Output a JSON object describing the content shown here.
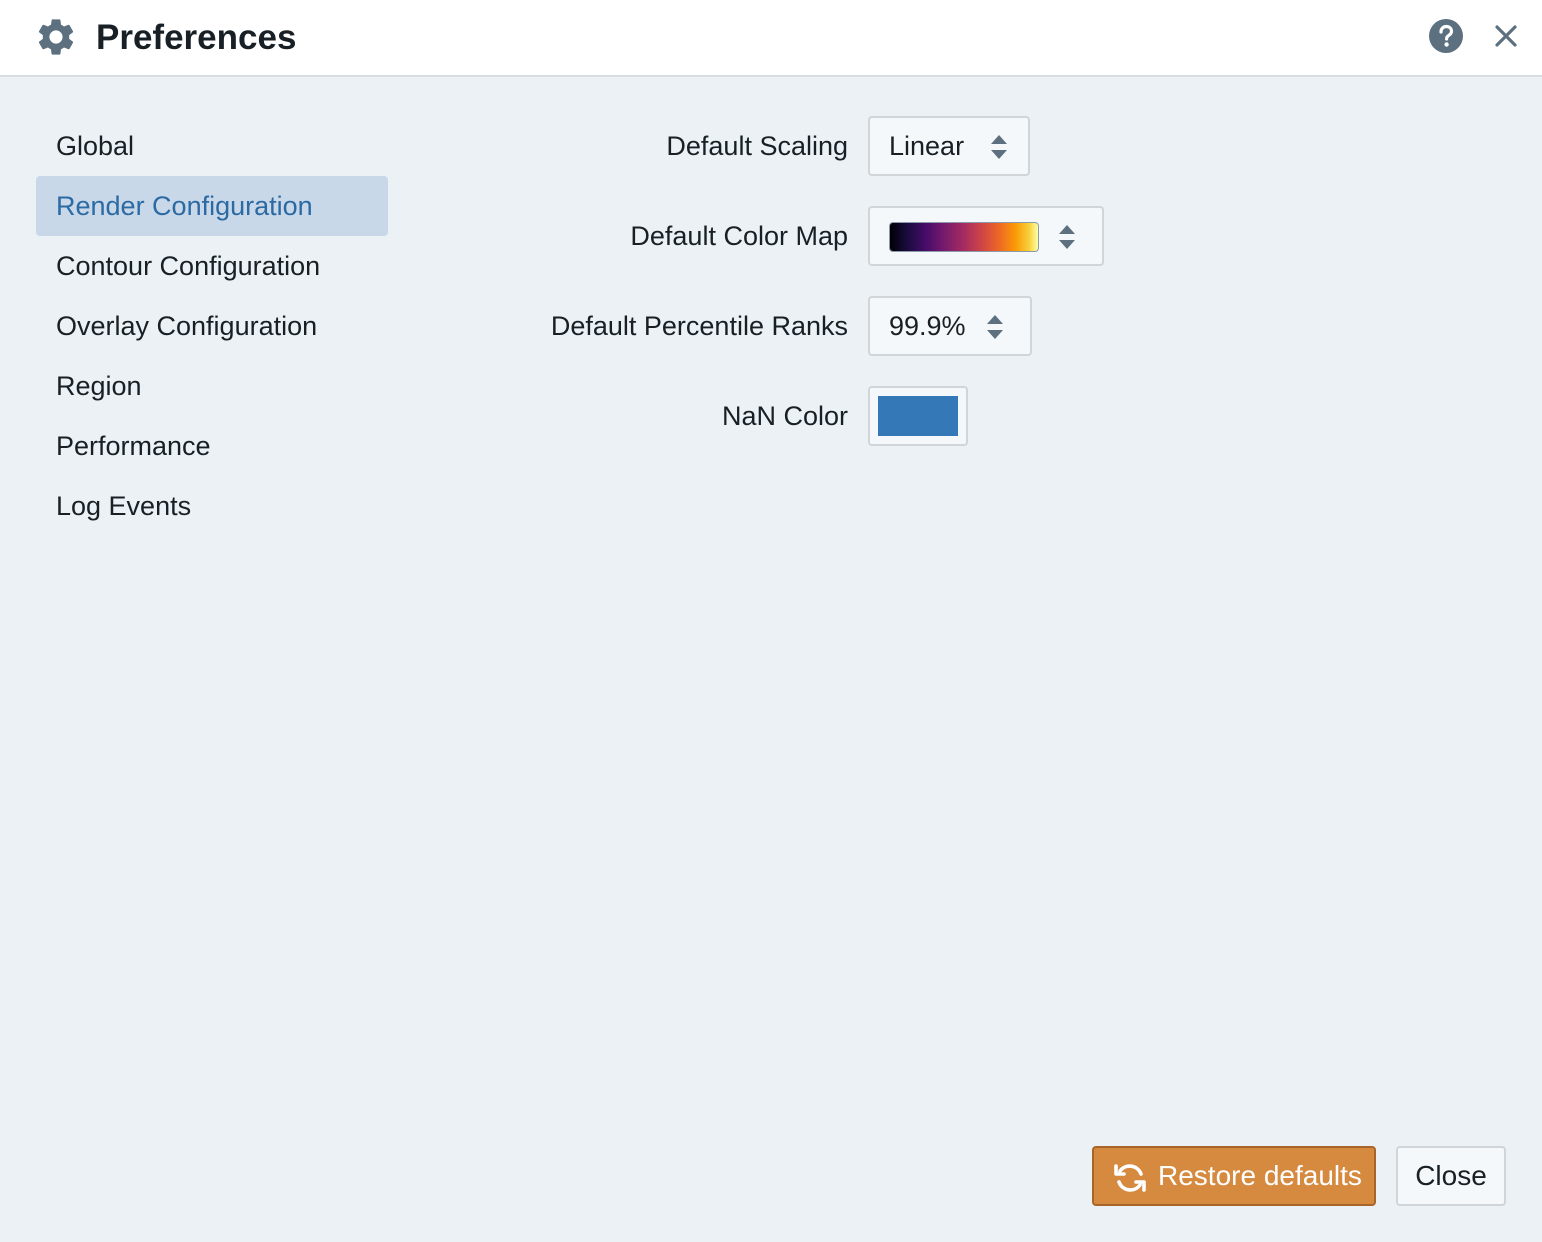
{
  "header": {
    "title": "Preferences",
    "icons": {
      "left": "gear-icon",
      "help": "question-circle-icon",
      "close": "close-icon"
    }
  },
  "nav": {
    "items": [
      {
        "label": "Global",
        "active": false
      },
      {
        "label": "Render Configuration",
        "active": true
      },
      {
        "label": "Contour Configuration",
        "active": false
      },
      {
        "label": "Overlay Configuration",
        "active": false
      },
      {
        "label": "Region",
        "active": false
      },
      {
        "label": "Performance",
        "active": false
      },
      {
        "label": "Log Events",
        "active": false
      }
    ]
  },
  "settings": {
    "scaling": {
      "label": "Default Scaling",
      "value": "Linear"
    },
    "colormap": {
      "label": "Default Color Map",
      "value_icon": "inferno-colormap-swatch"
    },
    "percentile": {
      "label": "Default Percentile Ranks",
      "value": "99.9%"
    },
    "nan_color": {
      "label": "NaN Color",
      "color": "#3478b8"
    }
  },
  "footer": {
    "restore_label": "Restore defaults",
    "restore_icon": "refresh-icon",
    "close_label": "Close"
  },
  "colors": {
    "accent_orange": "#d58a3f",
    "nav_active_bg": "#c8d8e8",
    "nav_active_text": "#2b6aa3",
    "background": "#ebf1f5",
    "icon_gray": "#5c7080"
  }
}
